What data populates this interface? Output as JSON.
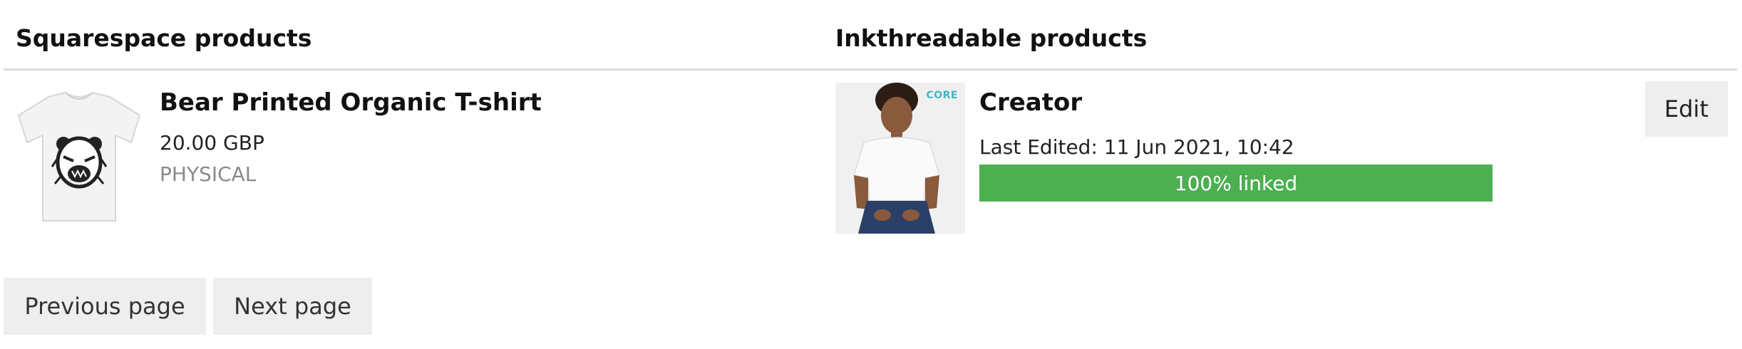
{
  "headers": {
    "squarespace": "Squarespace products",
    "inkthreadable": "Inkthreadable products"
  },
  "squarespace_product": {
    "image_icon": "bear-print-tshirt-image",
    "title": "Bear Printed Organic T-shirt",
    "price": "20.00 GBP",
    "type": "PHYSICAL"
  },
  "inkthreadable_product": {
    "image_icon": "model-in-white-tshirt-image",
    "image_tag": "CORE",
    "title": "Creator",
    "last_edited": "Last Edited: 11 Jun 2021, 10:42",
    "link_progress": 1.0,
    "link_progress_label": "100% linked",
    "edit_label": "Edit"
  },
  "pagination": {
    "previous_label": "Previous page",
    "next_label": "Next page"
  },
  "colors": {
    "progress_fill": "#4caf50",
    "button_bg": "#eeeeee",
    "divider": "#dddddd"
  }
}
